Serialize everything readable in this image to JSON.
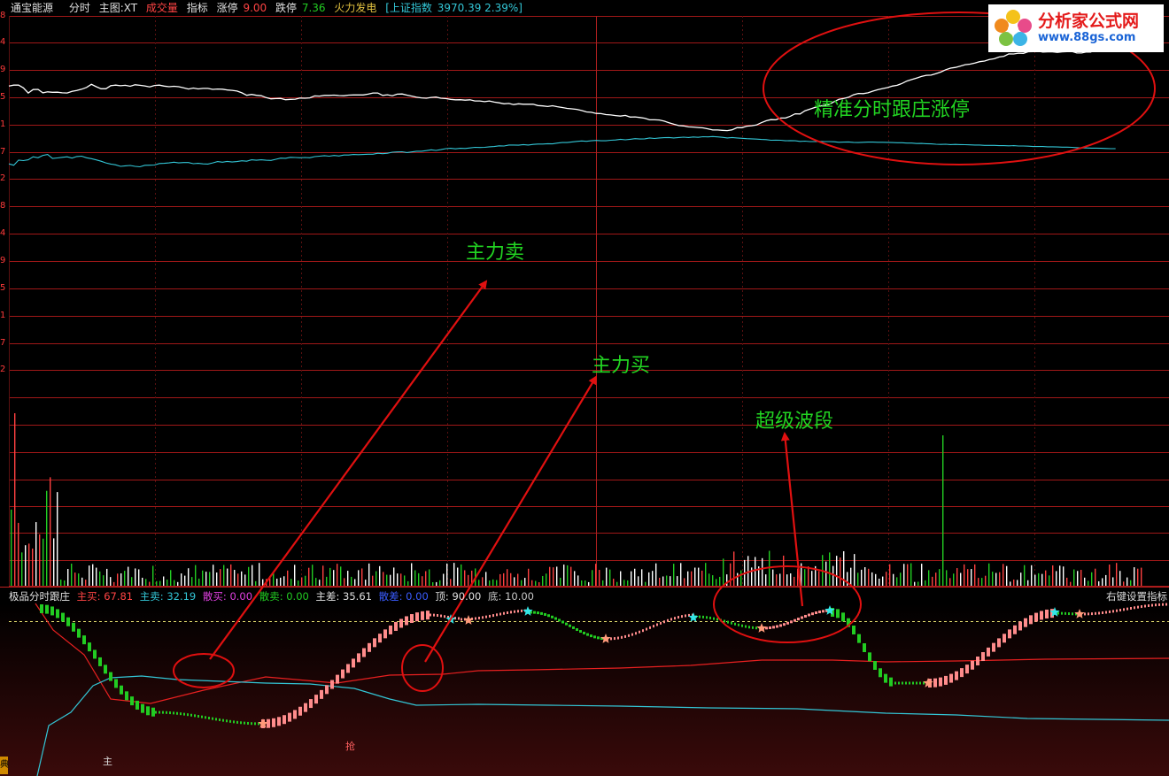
{
  "header": {
    "stock_name": "通宝能源",
    "tab_intraday": "分时",
    "main_chart": "主图:XT",
    "volume_label": "成交量",
    "indicator": "指标",
    "limit_up_label": "涨停",
    "limit_up_value": "9.00",
    "limit_down_label": "跌停",
    "limit_down_value": "7.36",
    "sector": "火力发电",
    "index_name": "[上证指数",
    "index_value": "3970.39 2.39%]"
  },
  "y_axis_labels": [
    "8",
    "4",
    "9",
    "5",
    "1",
    "7",
    "2",
    "8",
    "4",
    "9",
    "5",
    "1",
    "7",
    "2"
  ],
  "indicator_header": {
    "name": "极品分时跟庄",
    "buy_label": "主买:",
    "buy_value": "67.81",
    "sell_label": "主卖:",
    "sell_value": "32.19",
    "retail_buy_label": "散买:",
    "retail_buy_value": "0.00",
    "retail_sell_label": "散卖:",
    "retail_sell_value": "0.00",
    "diff_label": "主差:",
    "diff_value": "35.61",
    "retail_diff_label": "散差:",
    "retail_diff_value": "0.00",
    "top_label": "顶:",
    "top_value": "90.00",
    "bottom_label": "底:",
    "bottom_value": "10.00",
    "right_click": "右键设置指标"
  },
  "annotations": {
    "main_sell": "主力卖",
    "main_buy": "主力买",
    "super_wave": "超级波段",
    "precise": "精准分时跟庄涨停"
  },
  "logo": {
    "title": "分析家公式网",
    "url": "www.88gs.com"
  },
  "bottom_markers": {
    "zhu": "主",
    "qiang": "抢",
    "edge": "典"
  },
  "colors": {
    "price_line": "#ffffff",
    "avg_line": "#33c6d6",
    "grid": "#a01818",
    "buy_bar": "#ff8c8c",
    "sell_bar": "#22cc22",
    "annotation": "#22d522",
    "arrow": "#e01010"
  },
  "price_series": [
    0.47,
    0.53,
    0.53,
    0.36,
    0.05,
    0.26,
    0.27,
    0.06,
    0.12,
    0.09,
    0.1,
    0.06,
    0.05,
    0.15,
    0.2,
    0.28,
    0.39,
    0.58,
    0.43,
    0.31,
    0.31,
    0.5,
    0.53,
    0.49,
    0.52,
    0.46,
    0.55,
    0.52,
    0.48,
    0.42,
    0.51,
    0.53,
    0.47,
    0.43,
    0.46,
    0.43,
    0.37,
    0.29,
    0.35,
    0.3,
    0.33,
    0.33,
    0.27,
    0.29,
    0.28,
    0.23,
    0.21,
    0.17,
    0.06,
    -0.09,
    -0.04,
    -0.09,
    -0.12,
    -0.23,
    -0.31,
    -0.29,
    -0.28,
    -0.36,
    -0.34,
    -0.33,
    -0.26,
    -0.27,
    -0.25,
    -0.13,
    -0.14,
    -0.1,
    -0.1,
    -0.08,
    -0.11,
    -0.12,
    -0.08,
    -0.07,
    -0.07,
    -0.07,
    -0.02,
    0.05,
    0.05,
    -0.1,
    -0.06,
    -0.12,
    -0.02,
    -0.01,
    -0.08,
    -0.14,
    -0.21,
    -0.25,
    -0.27,
    -0.22,
    -0.2,
    -0.27,
    -0.29,
    -0.34,
    -0.37,
    -0.36,
    -0.39,
    -0.37,
    -0.44,
    -0.44,
    -0.48,
    -0.44,
    -0.51,
    -0.55,
    -0.61,
    -0.59,
    -0.66,
    -0.61,
    -0.64,
    -0.64,
    -0.64,
    -0.72,
    -0.74,
    -0.78,
    -0.73,
    -0.79,
    -0.84,
    -0.89,
    -0.92,
    -0.95,
    -1.02,
    -1.11,
    -1.13,
    -1.2,
    -1.21,
    -1.27,
    -1.29,
    -1.33,
    -1.36,
    -1.32,
    -1.42,
    -1.41,
    -1.45,
    -1.49,
    -1.59,
    -1.59,
    -1.6,
    -1.67,
    -1.77,
    -1.86,
    -1.94,
    -1.96,
    -2.02,
    -2.03,
    -2.06,
    -2.08,
    -2.14,
    -2.21,
    -2.21,
    -2.23,
    -2.25,
    -2.2,
    -2.07,
    -2.07,
    -1.98,
    -1.95,
    -1.91,
    -1.77,
    -1.65,
    -1.58,
    -1.59,
    -1.48,
    -1.48,
    -1.37,
    -1.22,
    -1.23,
    -1.04,
    -0.94,
    -0.84,
    -0.74,
    -0.72,
    -0.65,
    -0.48,
    -0.34,
    -0.28,
    -0.21,
    -0.06,
    0.02,
    0.01,
    0.06,
    0.16,
    0.25,
    0.32,
    0.38,
    0.47,
    0.52,
    0.63,
    0.78,
    0.87,
    0.96,
    1.06,
    1.13,
    1.14,
    1.23,
    1.33,
    1.47,
    1.57,
    1.61,
    1.69,
    1.78,
    1.81,
    1.88,
    1.96,
    2.0,
    2.1,
    2.14,
    2.25,
    2.29,
    2.44,
    2.43,
    2.48,
    2.47,
    2.57,
    2.58,
    2.61,
    2.55,
    2.56,
    2.56,
    2.53,
    2.56,
    2.58,
    2.59,
    2.49,
    2.49,
    2.55,
    2.55
  ],
  "avg_series": [
    0.12,
    0.04,
    0.35,
    0.32,
    0.37,
    0.55,
    0.49,
    0.64,
    0.69,
    0.45,
    0.48,
    0.52,
    0.55,
    0.47,
    0.57,
    0.59,
    0.49,
    0.44,
    0.36,
    0.28,
    0.18,
    0.11,
    0.06,
    -0.03,
    0.0,
    0.02,
    -0.03,
    -0.06,
    0.03,
    0.04,
    0.05,
    0.14,
    0.15,
    0.18,
    0.22,
    0.18,
    0.2,
    0.2,
    0.13,
    0.15,
    0.12,
    0.11,
    0.18,
    0.26,
    0.22,
    0.27,
    0.23,
    0.26,
    0.31,
    0.28,
    0.37,
    0.34,
    0.37,
    0.34,
    0.33,
    0.4,
    0.47,
    0.46,
    0.52,
    0.51,
    0.49,
    0.51,
    0.49,
    0.56,
    0.59,
    0.62,
    0.59,
    0.63,
    0.6,
    0.66,
    0.66,
    0.69,
    0.68,
    0.69,
    0.71,
    0.71,
    0.77,
    0.74,
    0.77,
    0.83,
    0.85,
    0.86,
    0.81,
    0.85,
    0.89,
    0.89,
    0.93,
    0.98,
    0.94,
    0.99,
    1.05,
    1.07,
    1.04,
    1.07,
    1.06,
    1.09,
    1.13,
    1.12,
    1.13,
    1.16,
    1.18,
    1.22,
    1.21,
    1.27,
    1.27,
    1.26,
    1.3,
    1.27,
    1.31,
    1.33,
    1.33,
    1.35,
    1.34,
    1.39,
    1.42,
    1.42,
    1.46,
    1.49,
    1.52,
    1.5,
    1.53,
    1.55,
    1.53,
    1.53,
    1.56,
    1.58,
    1.62,
    1.59,
    1.62,
    1.66,
    1.64,
    1.65,
    1.7,
    1.67,
    1.7,
    1.72,
    1.73,
    1.7,
    1.73,
    1.75,
    1.73,
    1.76,
    1.74,
    1.78,
    1.77,
    1.79,
    1.77,
    1.74,
    1.7,
    1.73,
    1.7,
    1.68,
    1.66,
    1.65,
    1.63,
    1.61,
    1.6,
    1.56,
    1.57,
    1.56,
    1.53,
    1.54,
    1.53,
    1.49,
    1.51,
    1.48,
    1.48,
    1.49,
    1.48,
    1.48,
    1.47,
    1.44,
    1.45,
    1.46,
    1.43,
    1.42,
    1.44,
    1.45,
    1.45,
    1.44,
    1.44,
    1.43,
    1.42,
    1.41,
    1.41,
    1.39,
    1.39,
    1.36,
    1.37,
    1.35,
    1.34,
    1.32,
    1.31,
    1.32,
    1.3,
    1.31,
    1.3,
    1.29,
    1.28,
    1.27,
    1.27,
    1.25,
    1.25,
    1.25,
    1.23,
    1.23,
    1.22,
    1.23,
    1.21,
    1.21,
    1.2,
    1.18,
    1.18,
    1.18,
    1.16,
    1.16,
    1.15,
    1.14,
    1.14,
    1.13,
    1.11,
    1.09,
    1.09,
    1.08,
    1.08,
    1.07,
    1.06,
    1.05,
    1.05
  ]
}
